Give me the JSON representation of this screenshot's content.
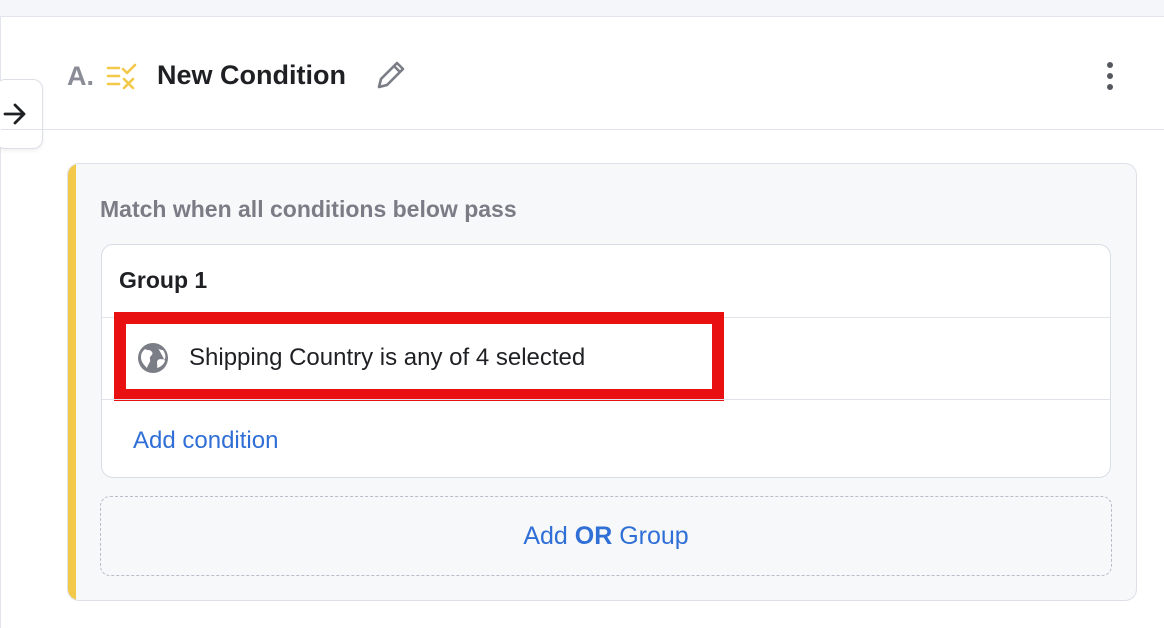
{
  "header": {
    "prefix": "A.",
    "title": "New Condition"
  },
  "card": {
    "match_text": "Match when all conditions below pass",
    "group": {
      "title": "Group 1",
      "conditions": [
        {
          "text": "Shipping Country is any of 4 selected",
          "icon": "globe-icon"
        }
      ],
      "add_condition_label": "Add condition"
    },
    "add_or_group": {
      "prefix": "Add",
      "keyword": "OR",
      "suffix": "Group"
    }
  },
  "colors": {
    "accent": "#f3c94a",
    "link": "#2f6fd6",
    "highlight": "#e81010"
  }
}
